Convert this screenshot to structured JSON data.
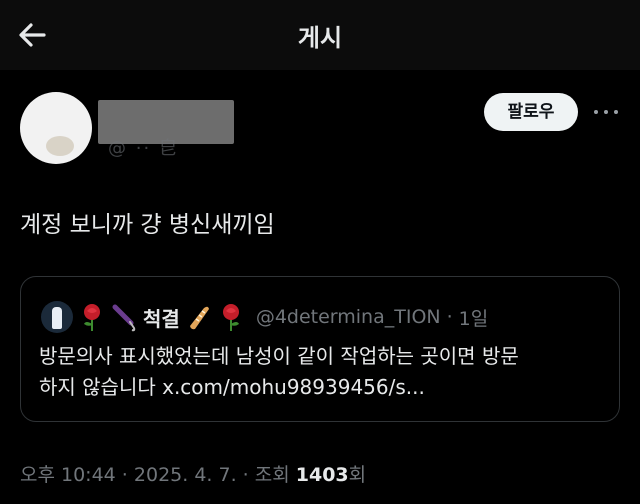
{
  "header": {
    "title": "게시",
    "back_icon": "arrow-left-icon"
  },
  "author": {
    "follow_label": "팔로우",
    "more_icon": "more-horizontal-icon"
  },
  "post": {
    "text": "계정 보니까 걍 병신새끼임"
  },
  "quote": {
    "name": "척결",
    "emojis": [
      "rose-icon",
      "umbrella-icon",
      "bread-icon",
      "rose-icon"
    ],
    "handle": "@4determina_TION",
    "separator": "·",
    "time": "1일",
    "body_line1": "방문의사 표시했었는데 남성이 같이 작업하는 곳이면 방문",
    "body_line2": "하지 않습니다 x.com/mohu98939456/s..."
  },
  "meta": {
    "time": "오후 10:44",
    "sep1": " · ",
    "date": "2025. 4. 7.",
    "sep2": " · ",
    "views_label": "조회 ",
    "views": "1403",
    "views_suffix": "회"
  },
  "colors": {
    "background": "#000000",
    "text": "#e7e9ea",
    "muted": "#71767b",
    "border": "#2f3336"
  }
}
